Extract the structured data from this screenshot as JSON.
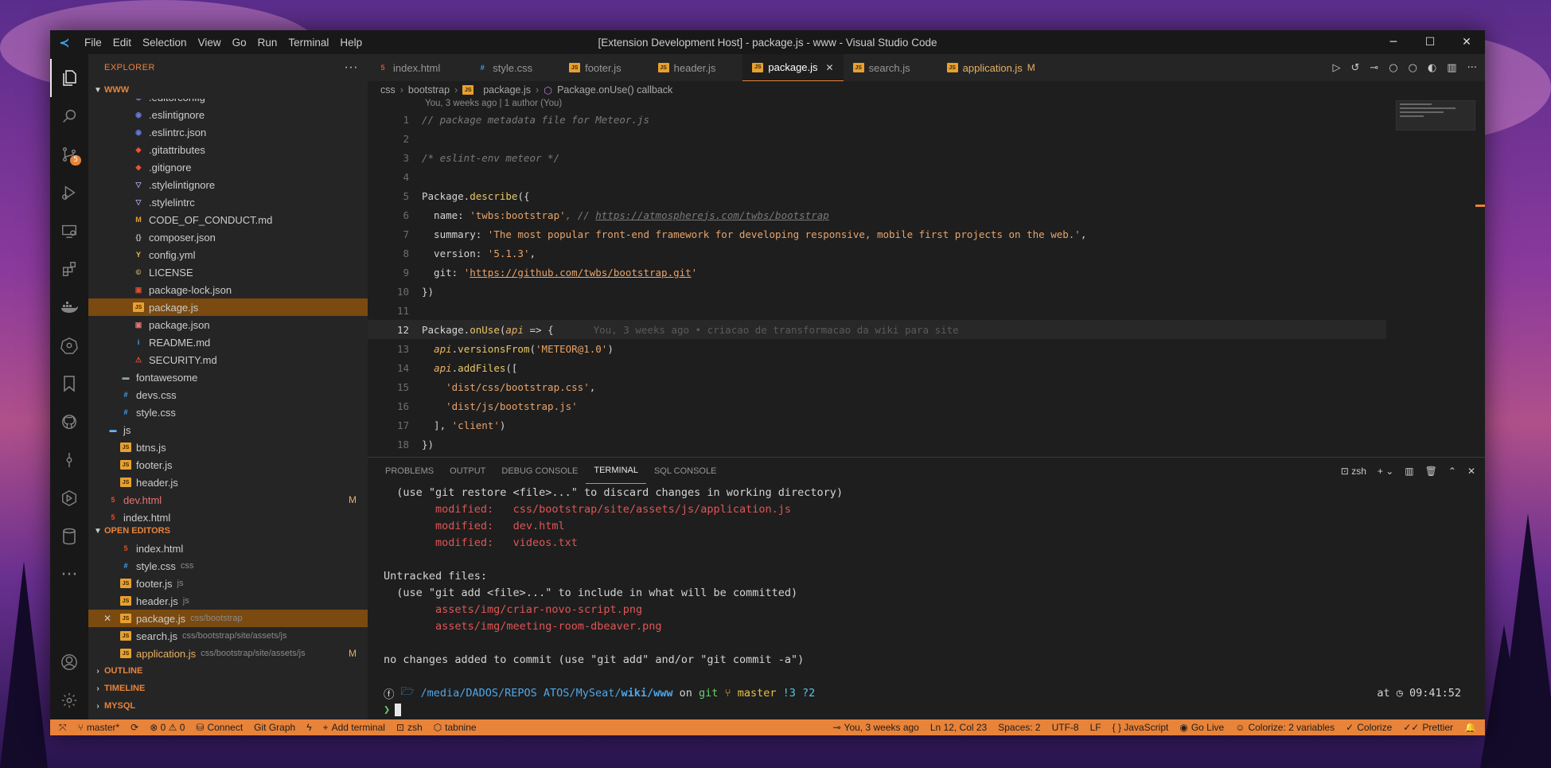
{
  "window": {
    "title": "[Extension Development Host] - package.js - www - Visual Studio Code",
    "menu": [
      "File",
      "Edit",
      "Selection",
      "View",
      "Go",
      "Run",
      "Terminal",
      "Help"
    ],
    "controls": {
      "minimize": "─",
      "maximize": "☐",
      "close": "✕"
    }
  },
  "activity_bar": {
    "icons": [
      "files-icon",
      "search-icon",
      "source-control-icon",
      "run-debug-icon",
      "remote-explorer-icon",
      "extensions-icon",
      "docker-icon",
      "kubernetes-icon",
      "bookmarks-icon",
      "github-icon",
      "git-graph-icon",
      "gitlens-icon",
      "database-icon",
      "more-icon",
      "account-icon",
      "settings-icon"
    ],
    "scm_badge": "5"
  },
  "sidebar": {
    "title": "EXPLORER",
    "more": "···",
    "root": "WWW",
    "files": [
      {
        "name": ".editorconfig",
        "icon": "dot",
        "depth": 3
      },
      {
        "name": ".eslintignore",
        "icon": "dot",
        "depth": 3
      },
      {
        "name": ".eslintrc.json",
        "icon": "dot",
        "depth": 3
      },
      {
        "name": ".gitattributes",
        "icon": "git",
        "depth": 3
      },
      {
        "name": ".gitignore",
        "icon": "git",
        "depth": 3
      },
      {
        "name": ".stylelintignore",
        "icon": "style",
        "depth": 3
      },
      {
        "name": ".stylelintrc",
        "icon": "style",
        "depth": 3
      },
      {
        "name": "CODE_OF_CONDUCT.md",
        "icon": "md",
        "depth": 3
      },
      {
        "name": "composer.json",
        "icon": "json",
        "depth": 3
      },
      {
        "name": "config.yml",
        "icon": "yml",
        "depth": 3
      },
      {
        "name": "LICENSE",
        "icon": "lic",
        "depth": 3
      },
      {
        "name": "package-lock.json",
        "icon": "lock",
        "depth": 3
      },
      {
        "name": "package.js",
        "icon": "js",
        "depth": 3,
        "selected": true
      },
      {
        "name": "package.json",
        "icon": "pkg",
        "depth": 3
      },
      {
        "name": "README.md",
        "icon": "info",
        "depth": 3
      },
      {
        "name": "SECURITY.md",
        "icon": "sec",
        "depth": 3
      },
      {
        "name": "fontawesome",
        "icon": "folder",
        "depth": 2
      },
      {
        "name": "devs.css",
        "icon": "css",
        "depth": 2
      },
      {
        "name": "style.css",
        "icon": "css",
        "depth": 2
      },
      {
        "name": "js",
        "icon": "fold-js",
        "depth": 1
      },
      {
        "name": "btns.js",
        "icon": "js",
        "depth": 2
      },
      {
        "name": "footer.js",
        "icon": "js",
        "depth": 2
      },
      {
        "name": "header.js",
        "icon": "js",
        "depth": 2
      },
      {
        "name": "dev.html",
        "icon": "html",
        "depth": 1,
        "modified": "M"
      },
      {
        "name": "index.html",
        "icon": "html",
        "depth": 1
      }
    ],
    "open_editors_title": "OPEN EDITORS",
    "open_editors": [
      {
        "name": "index.html",
        "icon": "html",
        "desc": ""
      },
      {
        "name": "style.css",
        "icon": "css",
        "desc": "css"
      },
      {
        "name": "footer.js",
        "icon": "js",
        "desc": "js"
      },
      {
        "name": "header.js",
        "icon": "js",
        "desc": "js"
      },
      {
        "name": "package.js",
        "icon": "js",
        "desc": "css/bootstrap",
        "selected": true
      },
      {
        "name": "search.js",
        "icon": "js",
        "desc": "css/bootstrap/site/assets/js"
      },
      {
        "name": "application.js",
        "icon": "js",
        "desc": "css/bootstrap/site/assets/js",
        "modified": "M"
      }
    ],
    "sections": [
      "OUTLINE",
      "TIMELINE",
      "MYSQL"
    ]
  },
  "tabs": [
    {
      "name": "index.html",
      "icon": "html"
    },
    {
      "name": "style.css",
      "icon": "css"
    },
    {
      "name": "footer.js",
      "icon": "js"
    },
    {
      "name": "header.js",
      "icon": "js"
    },
    {
      "name": "package.js",
      "icon": "js",
      "active": true
    },
    {
      "name": "search.js",
      "icon": "js"
    },
    {
      "name": "application.js",
      "icon": "js",
      "modified": "M"
    }
  ],
  "breadcrumb": [
    "css",
    "bootstrap",
    "package.js",
    "Package.onUse() callback"
  ],
  "editor": {
    "blame_header": "You, 3 weeks ago | 1 author (You)",
    "line_numbers": [
      "1",
      "2",
      "3",
      "4",
      "5",
      "6",
      "7",
      "8",
      "9",
      "10",
      "11",
      "12",
      "13",
      "14",
      "15",
      "16",
      "17",
      "18"
    ],
    "lines": {
      "l1": "// package metadata file for Meteor.js",
      "l3": "/* eslint-env meteor */",
      "l5a": "Package.",
      "l5b": "describe",
      "l5c": "({",
      "l6a": "  name: ",
      "l6b": "'twbs:bootstrap'",
      "l6c": ", // ",
      "l6d": "https://atmospherejs.com/twbs/bootstrap",
      "l7a": "  summary: ",
      "l7b": "'The most popular front-end framework for developing responsive, mobile first projects on the web.'",
      "l7c": ",",
      "l8a": "  version: ",
      "l8b": "'5.1.3'",
      "l8c": ",",
      "l9a": "  git: ",
      "l9b": "'",
      "l9c": "https://github.com/twbs/bootstrap.git",
      "l9d": "'",
      "l10": "})",
      "l12a": "Package.",
      "l12b": "onUse",
      "l12c": "(",
      "l12d": "api",
      "l12e": " => {",
      "l12blame": "You, 3 weeks ago • criacao de transformacao da wiki para site",
      "l13a": "  ",
      "l13b": "api",
      "l13c": ".",
      "l13d": "versionsFrom",
      "l13e": "(",
      "l13f": "'METEOR@1.0'",
      "l13g": ")",
      "l14a": "  ",
      "l14b": "api",
      "l14c": ".",
      "l14d": "addFiles",
      "l14e": "([",
      "l15a": "    ",
      "l15b": "'dist/css/bootstrap.css'",
      "l15c": ",",
      "l16a": "    ",
      "l16b": "'dist/js/bootstrap.js'",
      "l17a": "  ], ",
      "l17b": "'client'",
      "l17c": ")",
      "l18": "})"
    }
  },
  "panel": {
    "tabs": [
      "PROBLEMS",
      "OUTPUT",
      "DEBUG CONSOLE",
      "TERMINAL",
      "SQL CONSOLE"
    ],
    "active_tab": "TERMINAL",
    "shell": "zsh",
    "terminal": {
      "t1": "  (use \"git restore <file>...\" to discard changes in working directory)",
      "t2a": "        modified:   ",
      "t2b": "css/bootstrap/site/assets/js/application.js",
      "t3a": "        modified:   ",
      "t3b": "dev.html",
      "t4a": "        modified:   ",
      "t4b": "videos.txt",
      "t6": "Untracked files:",
      "t7": "  (use \"git add <file>...\" to include in what will be committed)",
      "t8": "        assets/img/criar-novo-script.png",
      "t9": "        assets/img/meeting-room-dbeaver.png",
      "t11": "no changes added to commit (use \"git add\" and/or \"git commit -a\")",
      "p_path1": "/media/DADOS/REPOS ATOS/MySeat/",
      "p_path2": "wiki/www",
      "p_on": " on ",
      "p_git": "git",
      "p_branch": " master ",
      "p_status": "!3 ?2",
      "p_at": "at ",
      "p_time": "09:41:52",
      "prompt": "❯"
    }
  },
  "statusbar": {
    "left": [
      "master*",
      "⊗ 0 ⚠ 0",
      "Connect",
      "Git Graph",
      "Add terminal",
      "zsh",
      "tabnine"
    ],
    "right": [
      "You, 3 weeks ago",
      "Ln 12, Col 23",
      "Spaces: 2",
      "UTF-8",
      "LF",
      "{ } JavaScript",
      "Go Live",
      "Colorize: 2 variables",
      "Colorize",
      "Prettier"
    ]
  }
}
